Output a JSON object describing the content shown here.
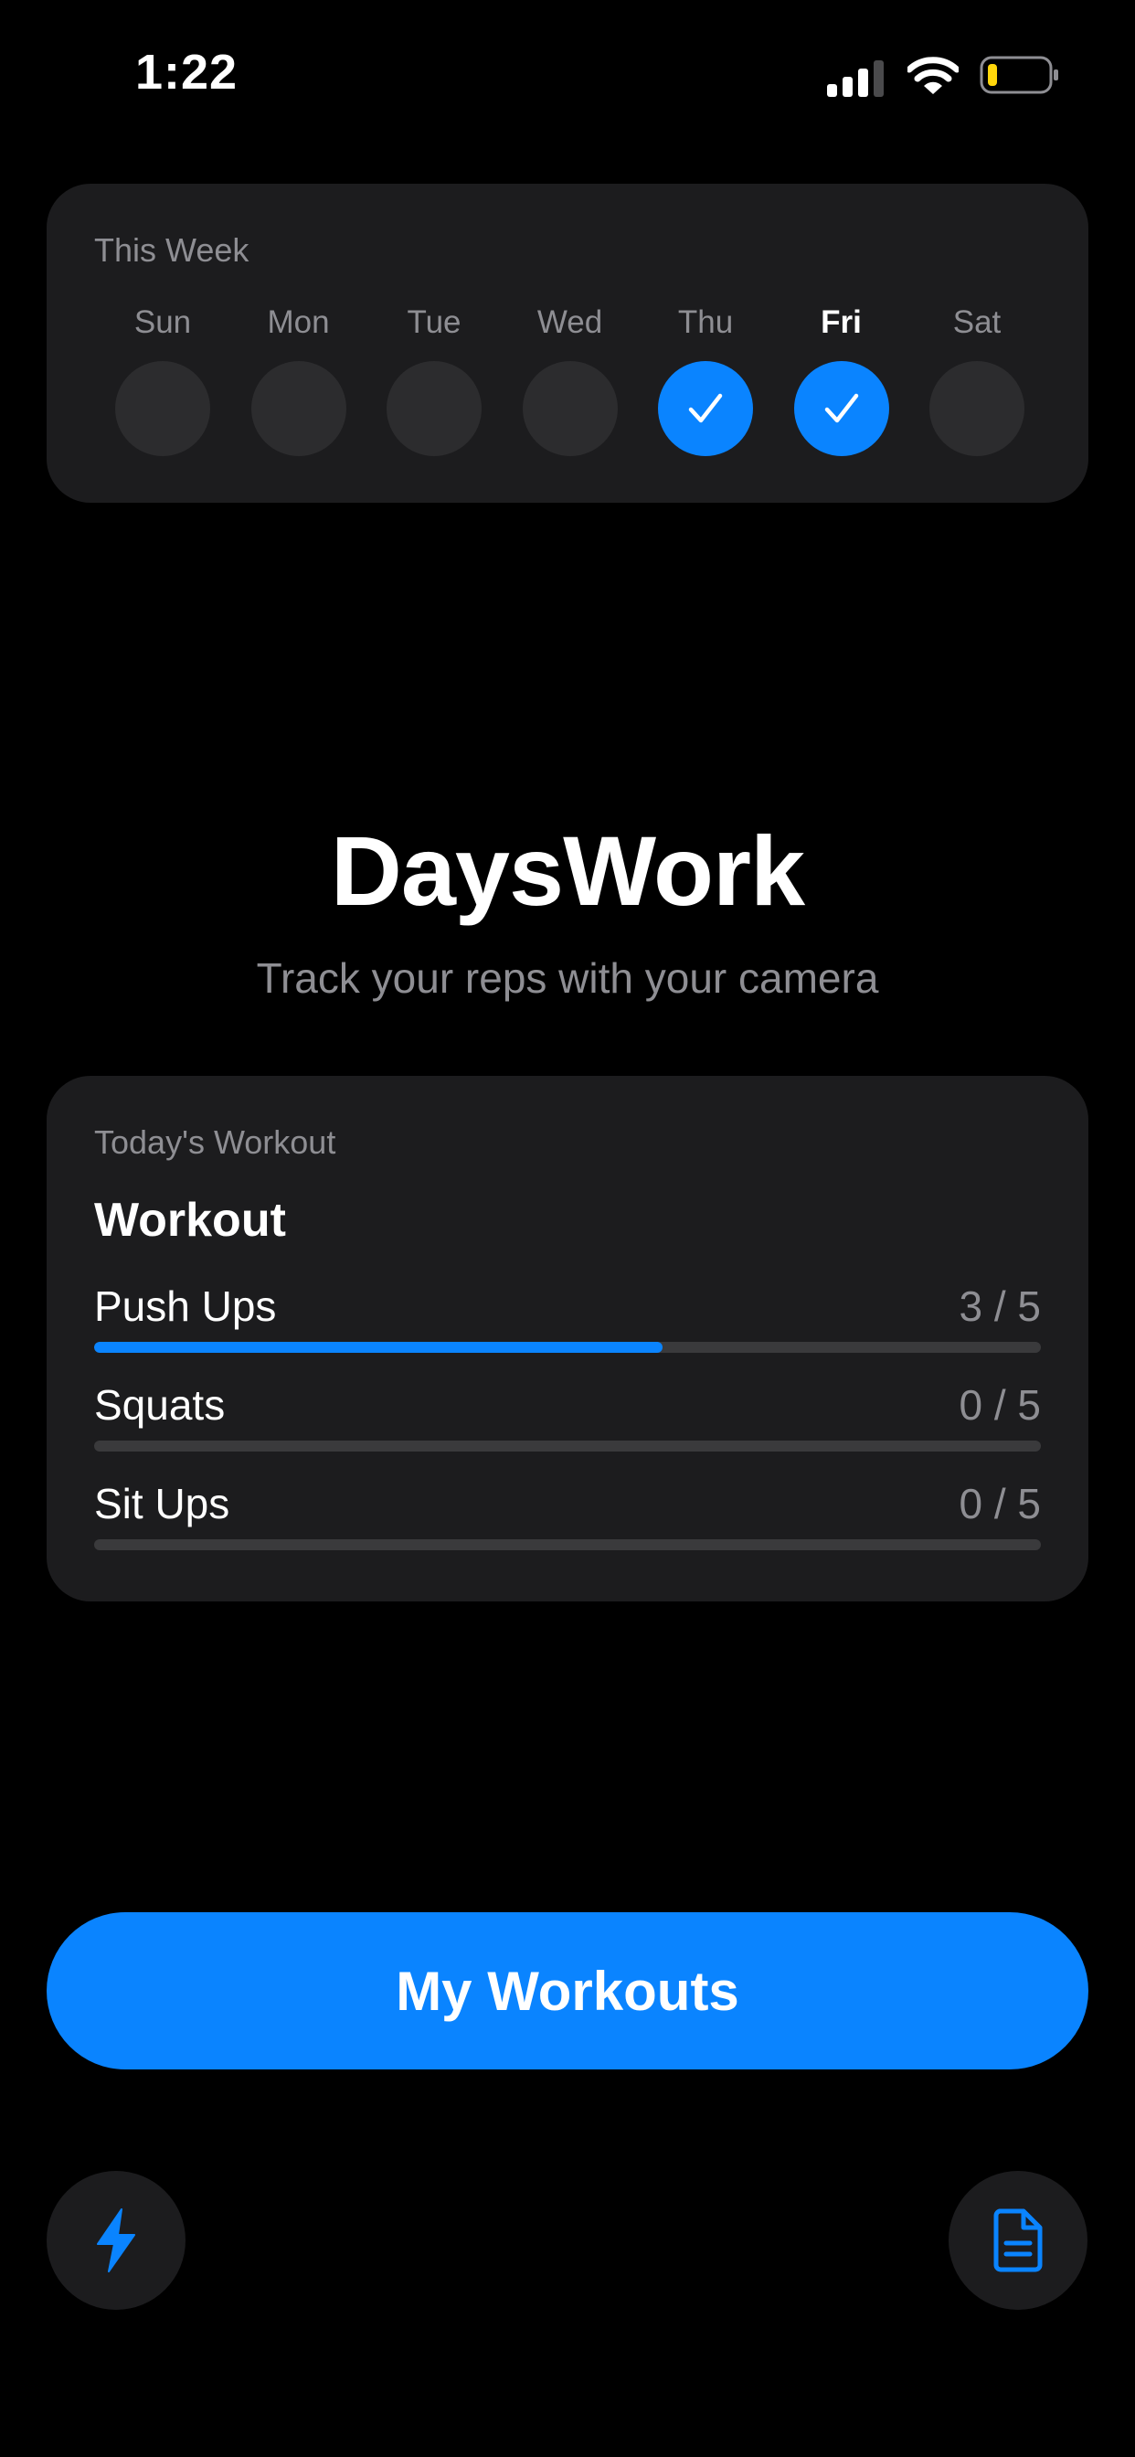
{
  "status_bar": {
    "time": "1:22",
    "icons": [
      "cellular-signal-icon",
      "wifi-icon",
      "battery-low-icon"
    ]
  },
  "week": {
    "caption": "This Week",
    "days": [
      {
        "label": "Sun",
        "done": false,
        "today": false
      },
      {
        "label": "Mon",
        "done": false,
        "today": false
      },
      {
        "label": "Tue",
        "done": false,
        "today": false
      },
      {
        "label": "Wed",
        "done": false,
        "today": false
      },
      {
        "label": "Thu",
        "done": true,
        "today": false
      },
      {
        "label": "Fri",
        "done": true,
        "today": true
      },
      {
        "label": "Sat",
        "done": false,
        "today": false
      }
    ]
  },
  "hero": {
    "title": "DaysWork",
    "subtitle": "Track your reps with your camera"
  },
  "today": {
    "caption": "Today's Workout",
    "workout_name": "Workout",
    "exercises": [
      {
        "name": "Push Ups",
        "count": "3 / 5",
        "done": 3,
        "target": 5
      },
      {
        "name": "Squats",
        "count": "0 / 5",
        "done": 0,
        "target": 5
      },
      {
        "name": "Sit Ups",
        "count": "0 / 5",
        "done": 0,
        "target": 5
      }
    ]
  },
  "actions": {
    "primary_label": "My Workouts",
    "left_icon": "bolt-icon",
    "right_icon": "document-icon"
  },
  "colors": {
    "accent": "#0a84ff",
    "card": "#1c1c1e",
    "muted_text": "#8e8e93",
    "empty_circle": "#2c2c2e",
    "track": "#3a3a3c"
  }
}
